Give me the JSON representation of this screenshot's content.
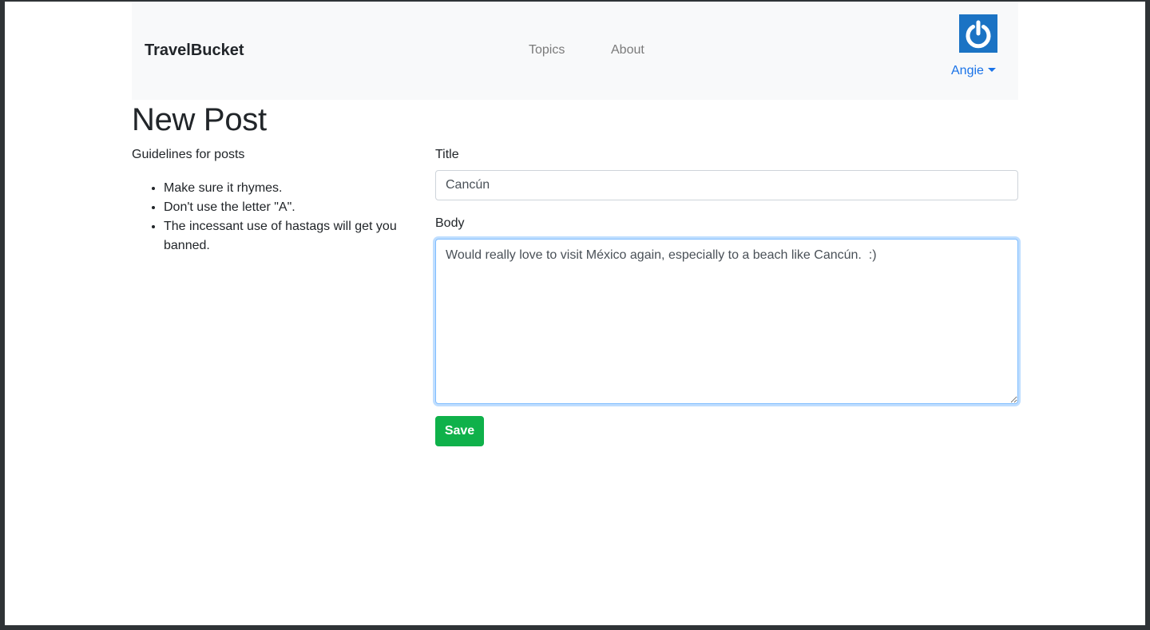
{
  "navbar": {
    "brand": "TravelBucket",
    "links": [
      {
        "label": "Topics"
      },
      {
        "label": "About"
      }
    ],
    "user": {
      "name": "Angie",
      "avatar_icon": "power-icon",
      "avatar_color": "#1b73c4"
    }
  },
  "page": {
    "title": "New Post"
  },
  "guidelines": {
    "heading": "Guidelines for posts",
    "items": [
      "Make sure it rhymes.",
      "Don't use the letter \"A\".",
      "The incessant use of hastags will get you banned."
    ]
  },
  "form": {
    "title_label": "Title",
    "title_value": "Cancún",
    "body_label": "Body",
    "body_value": "Would really love to visit México again, especially to a beach like Cancún.  :)",
    "save_label": "Save",
    "save_color": "#0fb14a"
  }
}
